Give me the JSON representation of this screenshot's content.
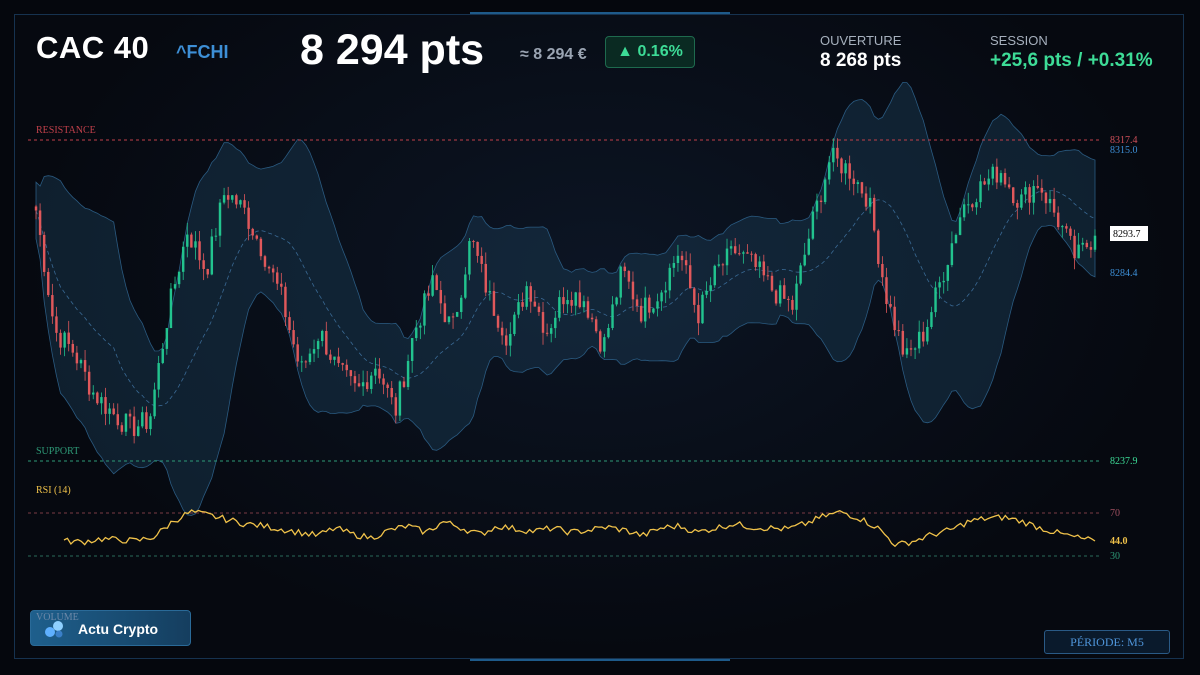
{
  "header": {
    "title": "CAC 40",
    "ticker": "^FCHI",
    "price": "8 294 pts",
    "approx": "≈ 8 294 €",
    "change_badge": "▲ 0.16%",
    "open_label": "OUVERTURE",
    "open_value": "8 268 pts",
    "session_label": "SESSION",
    "session_value": "+25,6 pts / +0.31%"
  },
  "levels": {
    "resistance_label": "RESISTANCE",
    "resistance_value": "8317.4",
    "upper_band_value": "8315.0",
    "current_value": "8293.7",
    "lower_band_value": "8284.4",
    "support_label": "SUPPORT",
    "support_value": "8237.9"
  },
  "rsi": {
    "label": "RSI (14)",
    "overbought": "70",
    "oversold": "30",
    "current": "44.0"
  },
  "footer": {
    "volume_label": "VOLUME",
    "brand": "Actu Crypto",
    "period": "PÉRIODE: M5"
  },
  "colors": {
    "up": "#22c38e",
    "down": "#e0585b",
    "resistance": "#c0404a",
    "support": "#2e9a77",
    "rsi": "#f0c24a",
    "band": "#1b3b55",
    "accent": "#3d8fd6"
  },
  "chart_data": {
    "type": "candlestick",
    "ylim": [
      8237.9,
      8317.4
    ],
    "resistance": 8317.4,
    "support": 8237.9,
    "last": 8293.7,
    "upper_band_last": 8315.0,
    "lower_band_last": 8284.4,
    "close_path": [
      8300,
      8270,
      8265,
      8255,
      8250,
      8246,
      8248,
      8275,
      8295,
      8285,
      8305,
      8300,
      8290,
      8278,
      8260,
      8270,
      8260,
      8255,
      8262,
      8250,
      8270,
      8282,
      8270,
      8293,
      8278,
      8268,
      8282,
      8270,
      8280,
      8278,
      8266,
      8285,
      8275,
      8280,
      8290,
      8274,
      8285,
      8290,
      8286,
      8280,
      8276,
      8296,
      8313,
      8310,
      8303,
      8278,
      8263,
      8270,
      8285,
      8301,
      8306,
      8310,
      8302,
      8307,
      8298,
      8288,
      8294
    ],
    "rsi": {
      "ylim": [
        30,
        70
      ],
      "values": [
        44,
        43,
        46,
        45,
        44,
        48,
        62,
        71,
        68,
        64,
        60,
        58,
        55,
        52,
        49,
        56,
        50,
        47,
        54,
        58,
        52,
        62,
        56,
        50,
        58,
        55,
        53,
        56,
        52,
        54,
        57,
        54,
        49,
        56,
        58,
        52,
        56,
        60,
        57,
        56,
        55,
        60,
        67,
        71,
        65,
        56,
        40,
        44,
        50,
        54,
        62,
        65,
        66,
        62,
        56,
        51,
        47,
        44
      ]
    }
  }
}
